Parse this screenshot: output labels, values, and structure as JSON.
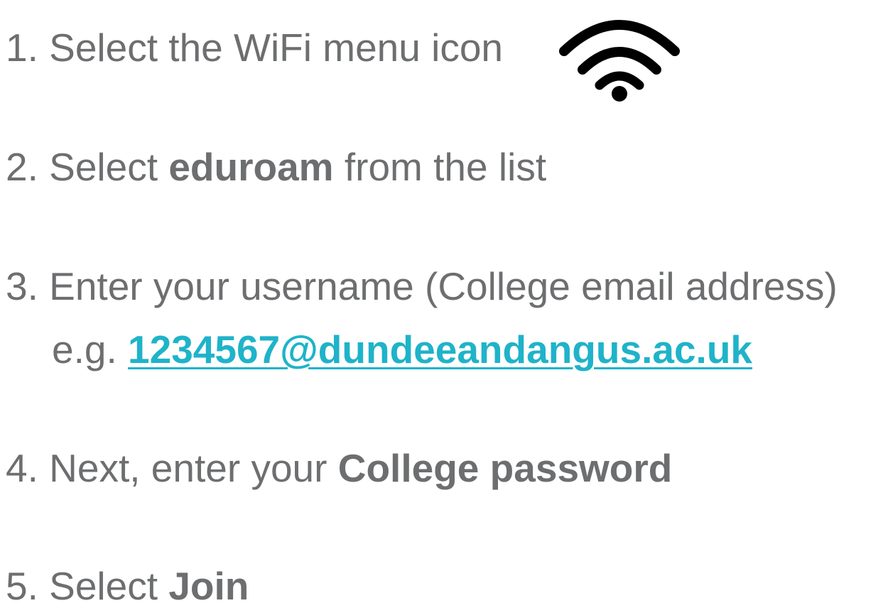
{
  "steps": {
    "s1": {
      "number": "1.",
      "text": "Select the WiFi menu icon"
    },
    "s2": {
      "number": "2.",
      "text_before": "Select ",
      "bold": "eduroam",
      "text_after": " from the list"
    },
    "s3": {
      "number": "3.",
      "text": "Enter your username (College email address)",
      "example_prefix": "e.g. ",
      "example_email": "1234567@dundeeandangus.ac.uk"
    },
    "s4": {
      "number": "4.",
      "text_before": "Next, enter your ",
      "bold": "College password"
    },
    "s5": {
      "number": "5.",
      "text_before": "Select ",
      "bold": "Join"
    }
  },
  "icons": {
    "wifi": "wifi-icon"
  },
  "colors": {
    "text": "#6d6e70",
    "link": "#1fb3c9",
    "icon": "#000000"
  }
}
